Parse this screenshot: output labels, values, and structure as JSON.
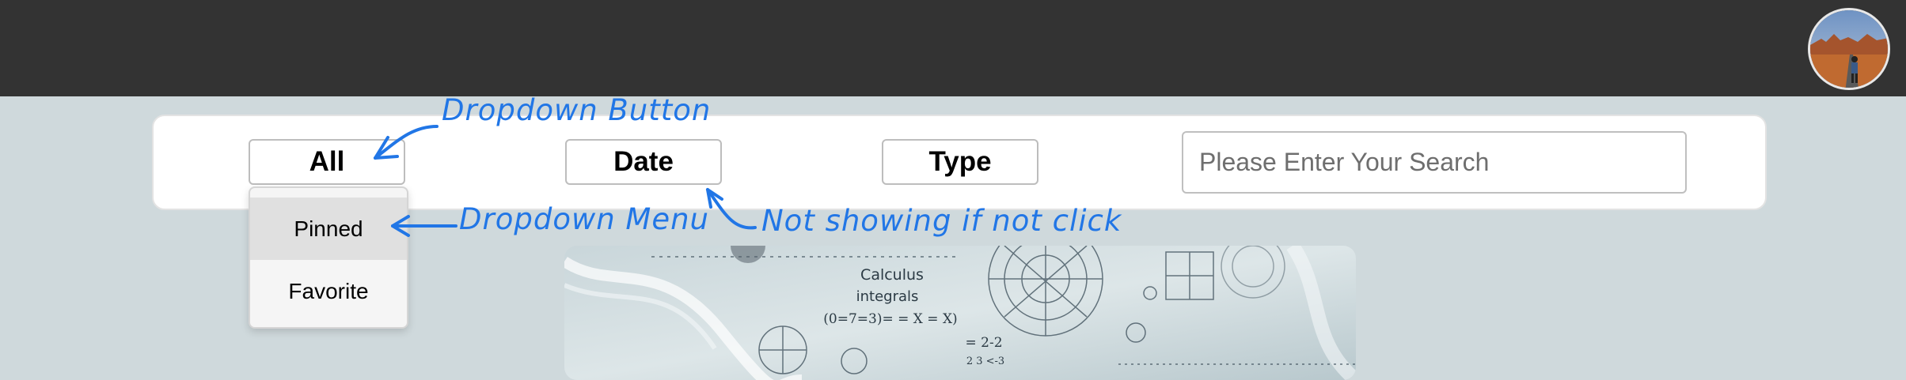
{
  "filters": {
    "all_label": "All",
    "date_label": "Date",
    "type_label": "Type"
  },
  "search": {
    "placeholder": "Please Enter Your Search",
    "value": ""
  },
  "dropdown": {
    "items": [
      {
        "label": "Pinned"
      },
      {
        "label": "Favorite"
      }
    ]
  },
  "banner": {
    "lines": [
      "Calculus",
      "integrals",
      "(0=7=3)= = X = X)",
      "= 2-2",
      "2 3 <-3"
    ]
  },
  "annotations": {
    "dropdown_button": "Dropdown Button",
    "dropdown_menu": "Dropdown Menu",
    "not_showing": "Not showing if not click"
  },
  "colors": {
    "topbar": "#333333",
    "background": "#cfd9dc",
    "annotation": "#2176e6"
  },
  "icons": {
    "profile_avatar": "avatar-photo"
  }
}
